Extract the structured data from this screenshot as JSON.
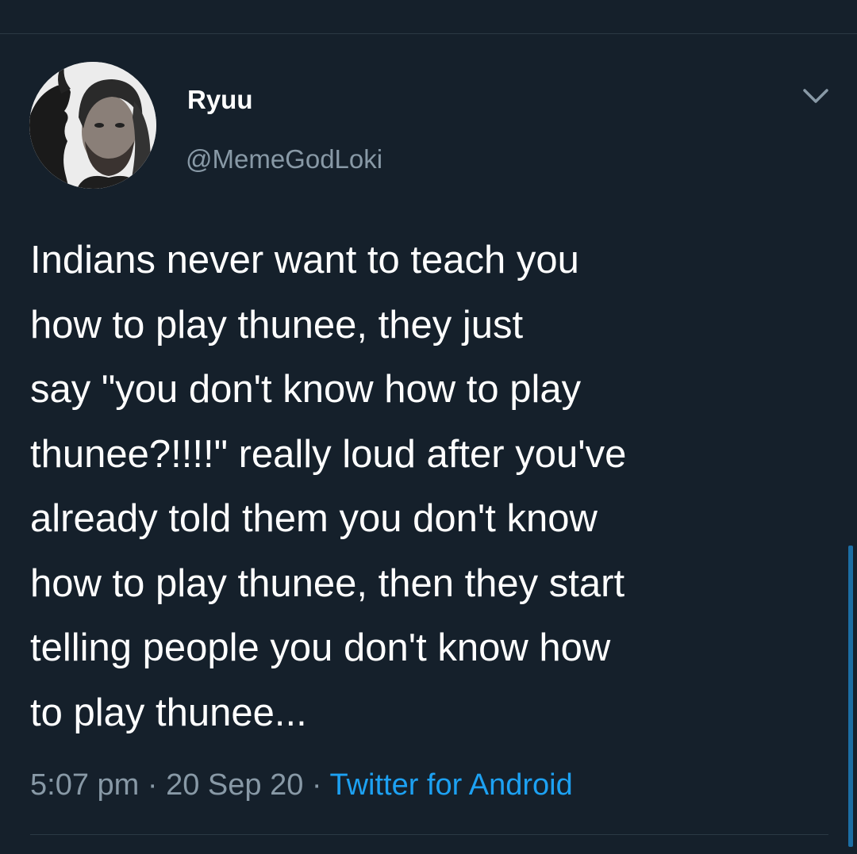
{
  "tweet": {
    "author": {
      "display_name": "Ryuu",
      "handle": "@MemeGodLoki",
      "avatar_icon": "profile-avatar"
    },
    "menu_icon": "chevron-down-icon",
    "text_lines": [
      "Indians never want to teach you",
      "how to play thunee, they just",
      "say \"you don't know how to play",
      "thunee?!!!!\" really loud after you've",
      "already told them you don't know",
      "how to play thunee, then they start",
      "telling people you don't know how",
      "to play thunee..."
    ],
    "time": "5:07 pm",
    "separator": "·",
    "date": "20 Sep 20",
    "source": "Twitter for Android"
  },
  "colors": {
    "background": "#15202b",
    "secondary_text": "#8899a6",
    "accent": "#1da1f2",
    "divider": "#2b3944"
  }
}
